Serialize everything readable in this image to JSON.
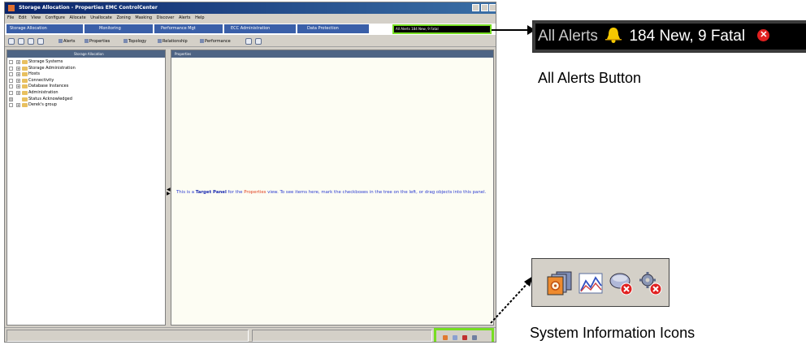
{
  "window": {
    "title": "Storage Allocation - Properties     EMC ControlCenter",
    "menu": [
      "File",
      "Edit",
      "View",
      "Configure",
      "Allocate",
      "Unallocate",
      "Zoning",
      "Masking",
      "Discover",
      "Alerts",
      "Help"
    ],
    "nav_tabs": [
      "Storage Allocation",
      "Monitoring",
      "Performance Mgt",
      "ECC Administration",
      "Data Protection"
    ],
    "alerts_mini": "All Alerts  184 New, 9 Fatal",
    "toolbar_items": [
      "Alerts",
      "Properties",
      "Topology",
      "Relationship",
      "Performance"
    ],
    "left_header": "Storage Allocation",
    "right_header": "Properties",
    "tree": [
      "Storage Systems",
      "Storage Administration",
      "Hosts",
      "Connectivity",
      "Database Instances",
      "Administration",
      "Status Acknowledged",
      "Derek's group"
    ],
    "target_panel": {
      "prefix": "This is a ",
      "bold": "Target Panel",
      "middle": " for the ",
      "view_name": "Properties",
      "suffix": " view. To see items here, mark the checkboxes in the tree on the left, or drag objects into this panel."
    }
  },
  "alerts_callout": {
    "label": "All Alerts",
    "counts": "184 New, 9 Fatal",
    "caption": "All Alerts Button"
  },
  "system_callout": {
    "caption": "System Information Icons",
    "icons": [
      "system-info-icon",
      "performance-graph-icon",
      "server-error-icon",
      "agent-error-icon"
    ]
  },
  "colors": {
    "highlight_border": "#77dd22",
    "nav_blue": "#3a5fa8",
    "target_text": "#2a3ad0",
    "alert_red": "#e02020"
  }
}
